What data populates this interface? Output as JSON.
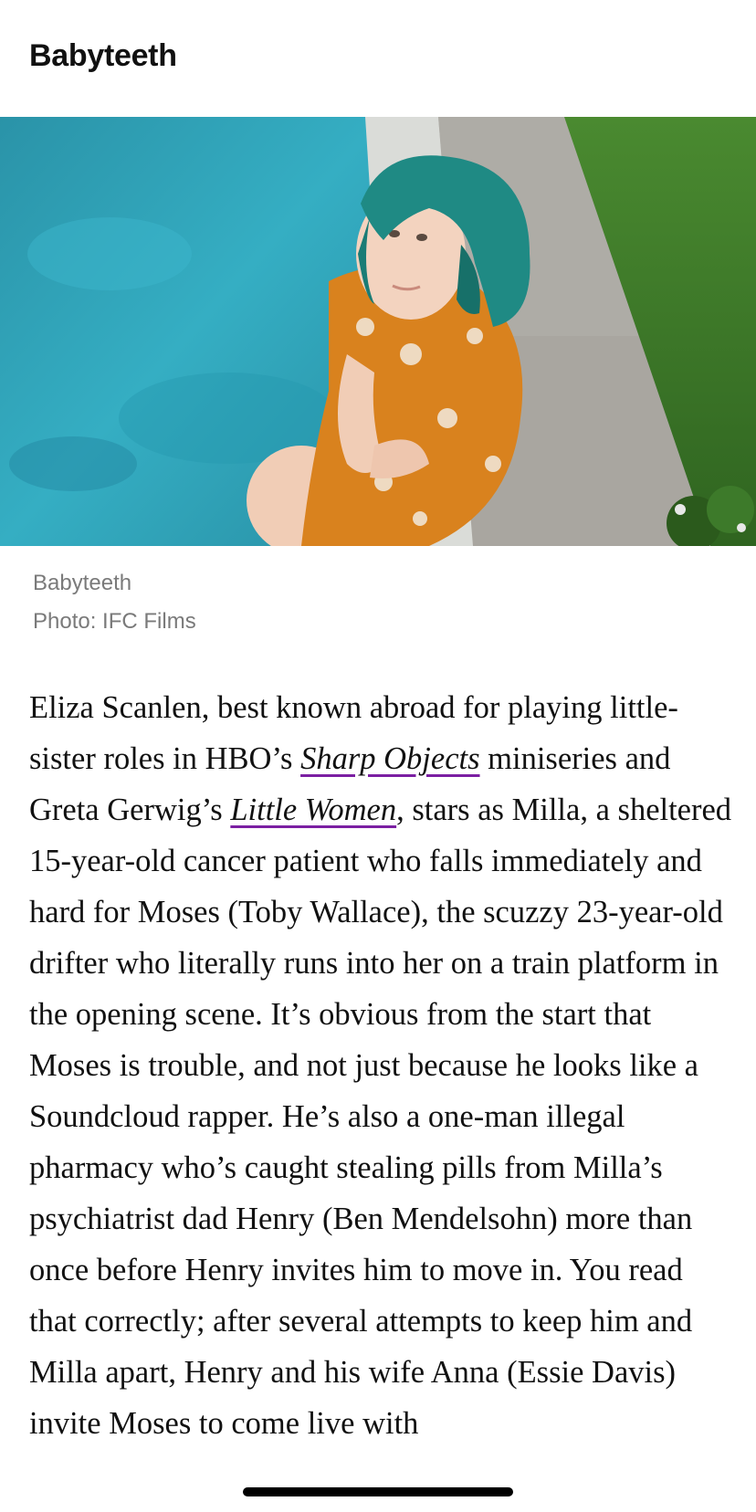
{
  "header": {
    "title": "Babyteeth"
  },
  "hero": {
    "image_label": "Photo of a girl with teal hair in an orange floral dress sitting at the edge of a swimming pool"
  },
  "caption": {
    "title": "Babyteeth",
    "credit": "Photo: IFC Films"
  },
  "article": {
    "part1": "Eliza Scanlen, best known abroad for playing little-sister roles in HBO’s ",
    "link1": "Sharp Objects",
    "part2": " miniseries and Greta Gerwig’s ",
    "link2": "Little Women",
    "part3": ", stars as Milla, a sheltered 15-year-old cancer patient who falls immediately and hard for Moses (Toby Wallace), the scuzzy 23-year-old drifter who literally runs into her on a train platform in the opening scene. It’s obvious from the start that Moses is trouble, and not just because he looks like a Soundcloud rapper. He’s also a one-man illegal pharmacy who’s caught stealing pills from Milla’s psychiatrist dad Henry (Ben Mendelsohn) more than once before Henry invites him to move in. You read that correctly; after several attempts to keep him and Milla apart, Henry and his wife Anna (Essie Davis) invite Moses to come live with"
  },
  "colors": {
    "link_underline": "#7b1fa2",
    "pool": "#2fa3b8",
    "hair": "#1f8a84",
    "dress": "#d9821e",
    "grass": "#3f7a2a"
  }
}
